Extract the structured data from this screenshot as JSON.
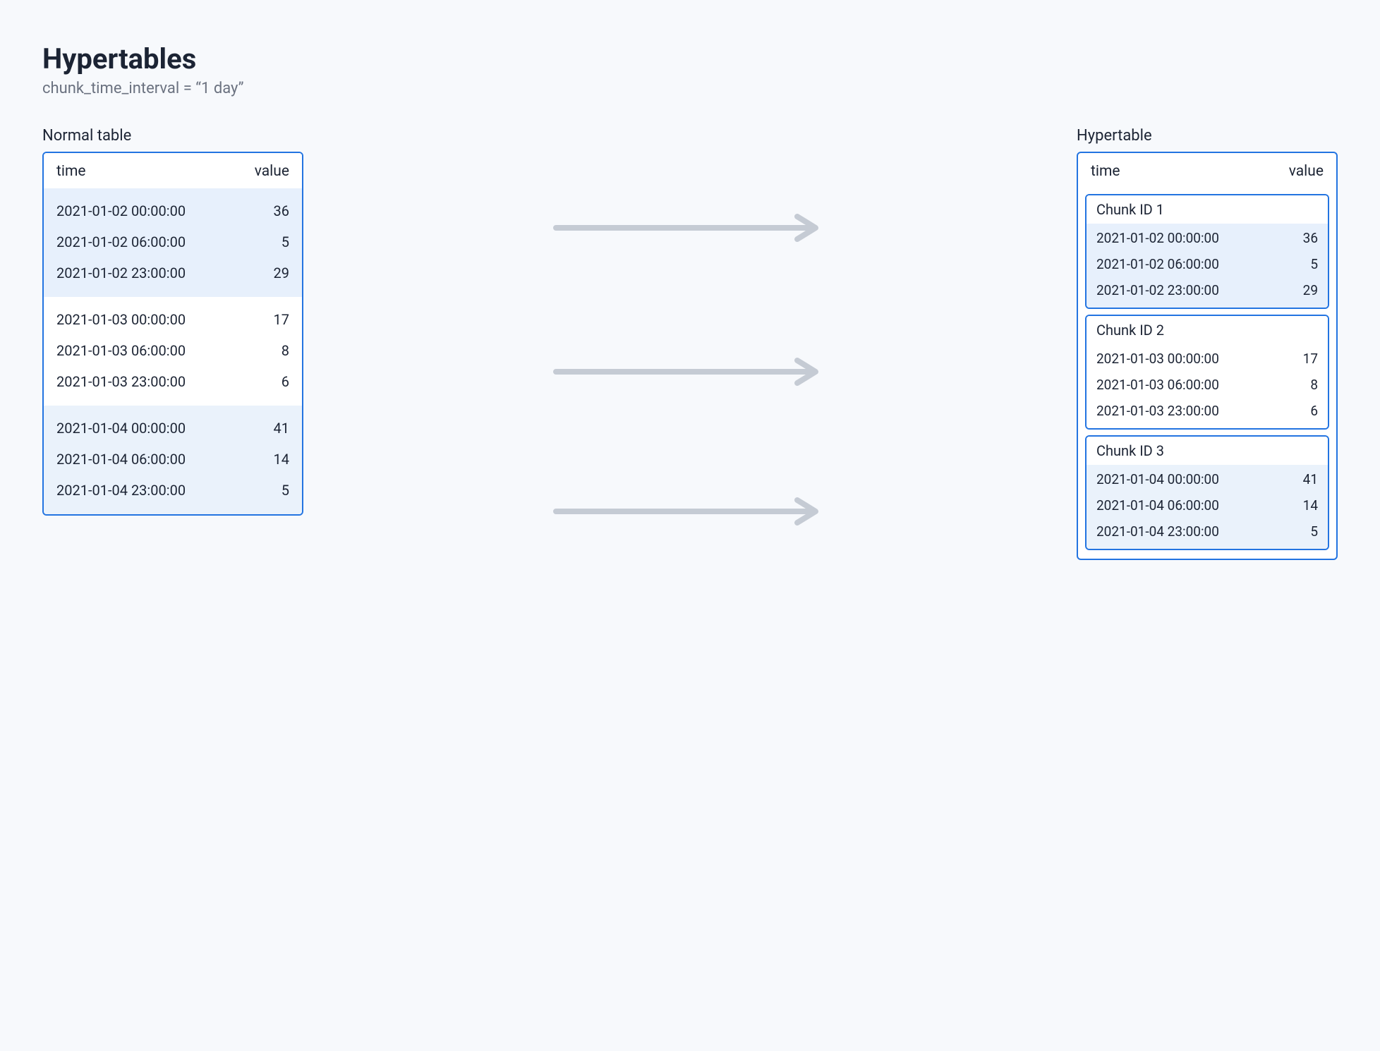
{
  "title": "Hypertables",
  "subtitle": "chunk_time_interval = “1 day”",
  "labels": {
    "normal": "Normal table",
    "hyper": "Hypertable",
    "time_header": "time",
    "value_header": "value"
  },
  "normal_table": {
    "groups": [
      {
        "tint": "group-a",
        "rows": [
          {
            "time": "2021-01-02 00:00:00",
            "value": "36"
          },
          {
            "time": "2021-01-02 06:00:00",
            "value": "5"
          },
          {
            "time": "2021-01-02 23:00:00",
            "value": "29"
          }
        ]
      },
      {
        "tint": "group-b",
        "rows": [
          {
            "time": "2021-01-03 00:00:00",
            "value": "17"
          },
          {
            "time": "2021-01-03 06:00:00",
            "value": "8"
          },
          {
            "time": "2021-01-03 23:00:00",
            "value": "6"
          }
        ]
      },
      {
        "tint": "group-c",
        "rows": [
          {
            "time": "2021-01-04 00:00:00",
            "value": "41"
          },
          {
            "time": "2021-01-04 06:00:00",
            "value": "14"
          },
          {
            "time": "2021-01-04 23:00:00",
            "value": "5"
          }
        ]
      }
    ]
  },
  "hypertable": {
    "chunks": [
      {
        "label": "Chunk ID 1",
        "tint": "tint-a",
        "rows": [
          {
            "time": "2021-01-02 00:00:00",
            "value": "36"
          },
          {
            "time": "2021-01-02 06:00:00",
            "value": "5"
          },
          {
            "time": "2021-01-02 23:00:00",
            "value": "29"
          }
        ]
      },
      {
        "label": "Chunk ID 2",
        "tint": "tint-b",
        "rows": [
          {
            "time": "2021-01-03 00:00:00",
            "value": "17"
          },
          {
            "time": "2021-01-03 06:00:00",
            "value": "8"
          },
          {
            "time": "2021-01-03 23:00:00",
            "value": "6"
          }
        ]
      },
      {
        "label": "Chunk ID 3",
        "tint": "tint-c",
        "rows": [
          {
            "time": "2021-01-04 00:00:00",
            "value": "41"
          },
          {
            "time": "2021-01-04 06:00:00",
            "value": "14"
          },
          {
            "time": "2021-01-04 23:00:00",
            "value": "5"
          }
        ]
      }
    ]
  }
}
